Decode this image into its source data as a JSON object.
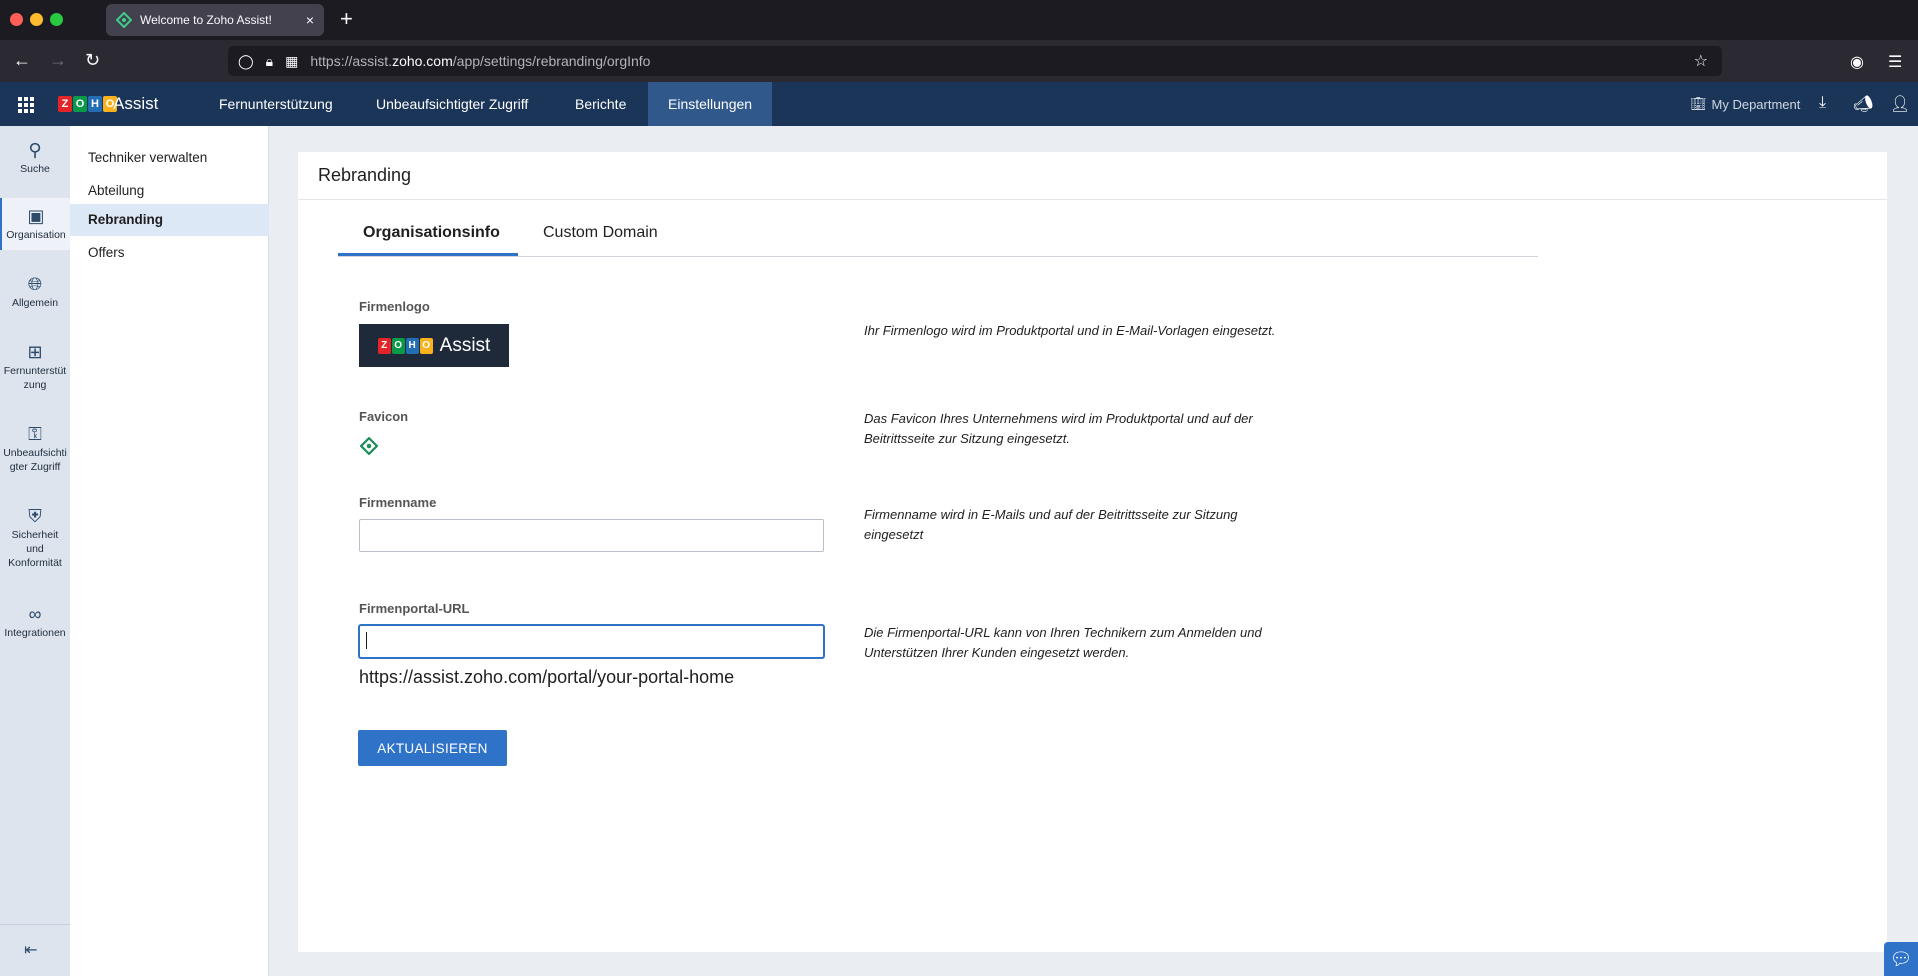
{
  "browser": {
    "tab_title": "Welcome to Zoho Assist!",
    "tab_close": "×",
    "new_tab": "+",
    "url_prefix": "https://assist.",
    "url_domain": "zoho.com",
    "url_path": "/app/settings/rebranding/orgInfo"
  },
  "app": {
    "brand_letters": [
      "Z",
      "O",
      "H",
      "O"
    ],
    "brand_colors": [
      "#e42527",
      "#089949",
      "#226db4",
      "#f9b21d"
    ],
    "product": "Assist",
    "nav": [
      "Fernunterstützung",
      "Unbeaufsichtigter Zugriff",
      "Berichte",
      "Einstellungen"
    ],
    "active_nav": "Einstellungen",
    "department": "My Department"
  },
  "rail": [
    {
      "label": "Suche",
      "icon": "search-icon"
    },
    {
      "label": "Organisation",
      "icon": "org-icon"
    },
    {
      "label": "Allgemein",
      "icon": "globe-icon"
    },
    {
      "label": "Fernunterstüt zung",
      "icon": "remote-support-icon"
    },
    {
      "label": "Unbeaufsichti gter Zugriff",
      "icon": "unattended-icon"
    },
    {
      "label": "Sicherheit und Konformität",
      "icon": "shield-icon"
    },
    {
      "label": "Integrationen",
      "icon": "integrations-icon"
    }
  ],
  "subnav": [
    "Techniker verwalten",
    "Abteilung",
    "Rebranding",
    "Offers"
  ],
  "content": {
    "title": "Rebranding",
    "tabs": [
      "Organisationsinfo",
      "Custom Domain"
    ],
    "fields": {
      "logo_label": "Firmenlogo",
      "logo_desc": "Ihr Firmenlogo wird im Produktportal und in E-Mail-Vorlagen eingesetzt.",
      "favicon_label": "Favicon",
      "favicon_desc": "Das Favicon Ihres Unternehmens wird im Produktportal und auf der Beitrittsseite zur Sitzung eingesetzt.",
      "name_label": "Firmenname",
      "name_value": "",
      "name_desc": "Firmenname wird in E-Mails und auf der Beitrittsseite zur Sitzung eingesetzt",
      "url_label": "Firmenportal-URL",
      "url_value": "",
      "url_desc": "Die Firmenportal-URL kann von Ihren Technikern zum Anmelden und Unterstützen Ihrer Kunden eingesetzt werden.",
      "portal_url": "https://assist.zoho.com/portal/your-portal-home"
    },
    "update_button": "AKTUALISIEREN"
  }
}
